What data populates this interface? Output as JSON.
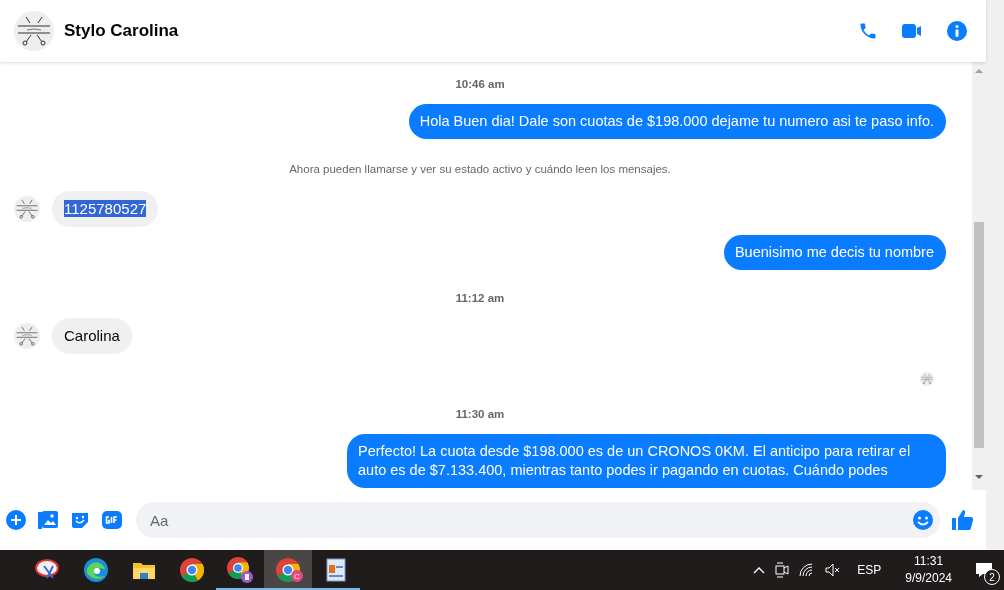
{
  "header": {
    "name": "Stylo Carolina"
  },
  "messages": [
    {
      "kind": "time",
      "text": "10:46 am"
    },
    {
      "kind": "outgoing",
      "text": "Hola Buen dia! Dale son cuotas de $198.000 dejame tu numero asi te paso info."
    },
    {
      "kind": "system",
      "text": "Ahora pueden llamarse y ver su estado activo y cuándo leen los mensajes."
    },
    {
      "kind": "incoming",
      "text": "1125780527",
      "selected": true
    },
    {
      "kind": "outgoing",
      "text": "Buenisimo me decis tu nombre"
    },
    {
      "kind": "time",
      "text": "11:12 am"
    },
    {
      "kind": "incoming",
      "text": "Carolina",
      "selected": false
    },
    {
      "kind": "seen"
    },
    {
      "kind": "time",
      "text": "11:30 am"
    },
    {
      "kind": "outgoing",
      "text": "Perfecto! La cuota desde $198.000 es de un CRONOS 0KM. El anticipo para retirar el auto es de $7.133.400, mientras tanto podes ir pagando en cuotas. Cuándo podes"
    }
  ],
  "composer": {
    "placeholder": "Aa"
  },
  "taskbar": {
    "apps": [
      {
        "kind": "snip",
        "running": false,
        "selected": false
      },
      {
        "kind": "edge",
        "running": false,
        "selected": false
      },
      {
        "kind": "folder",
        "running": false,
        "selected": false
      },
      {
        "kind": "chrome",
        "running": false,
        "selected": false
      },
      {
        "kind": "chrome-profile",
        "running": true,
        "selected": false
      },
      {
        "kind": "chrome-c",
        "badge": "C",
        "running": true,
        "selected": true
      },
      {
        "kind": "editor",
        "running": true,
        "selected": false
      }
    ],
    "language": "ESP",
    "time": "11:31",
    "date": "9/9/2024",
    "notifications": "2"
  }
}
